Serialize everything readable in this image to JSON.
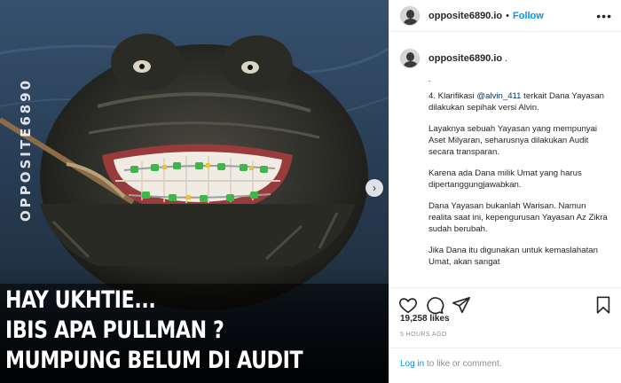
{
  "post": {
    "watermark": "OPPOSITE6890",
    "caption_lines": [
      "HAY UKHTIE...",
      "IBIS APA PULLMAN ?",
      "MUMPUNG BELUM DI AUDIT"
    ]
  },
  "header": {
    "username": "opposite6890.io",
    "separator": "•",
    "follow_label": "Follow",
    "more_label": "•••"
  },
  "comment": {
    "username": "opposite6890.io",
    "tail": ".",
    "dot_line": ".",
    "line_klarifikasi_prefix": "4. Klarifikasi ",
    "mention": "@alvin_411",
    "line_klarifikasi_suffix": " terkait Dana Yayasan dilakukan sepihak versi Alvin.",
    "p2": "Layaknya sebuah Yayasan yang mempunyai Aset Milyaran, seharusnya dilakukan Audit secara transparan.",
    "p3": "Karena ada Dana milik Umat yang harus dipertanggungjawabkan.",
    "p4": "Dana Yayasan bukanlah Warisan. Namun realita saat ini, kepengurusan Yayasan Az Zikra sudah berubah.",
    "p5": "Jika Dana itu digunakan untuk kemaslahatan Umat, akan sangat"
  },
  "stats": {
    "likes": "19,258 likes",
    "time": "5 HOURS AGO"
  },
  "login": {
    "link": "Log in",
    "rest": " to like or comment."
  },
  "icons": [
    "heart-icon",
    "comment-icon",
    "share-icon",
    "bookmark-icon",
    "next-arrow-icon",
    "more-icon"
  ]
}
